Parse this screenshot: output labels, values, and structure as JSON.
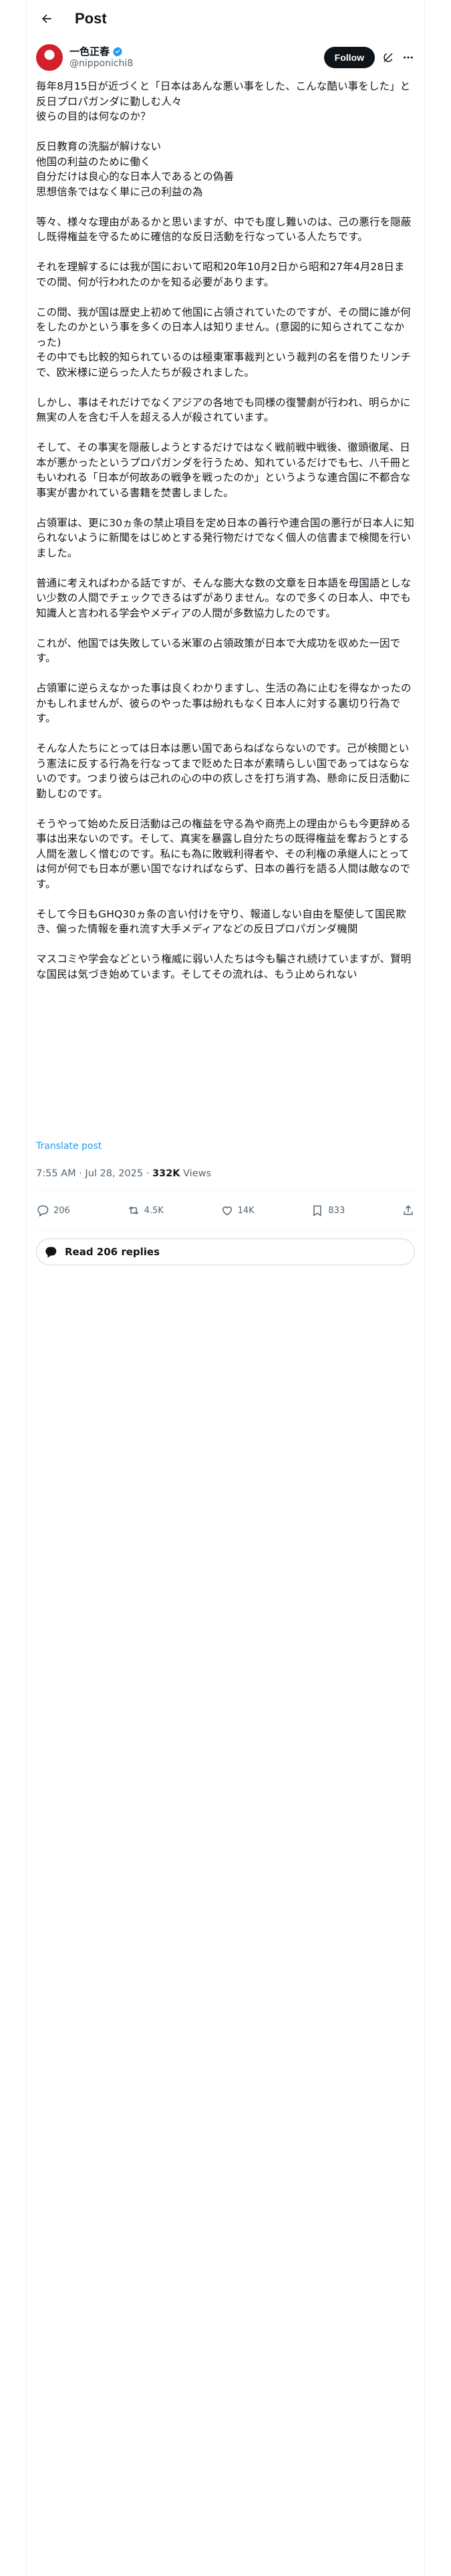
{
  "header": {
    "title": "Post"
  },
  "author": {
    "display_name": "一色正春",
    "handle": "@nipponichi8",
    "follow_label": "Follow"
  },
  "post": {
    "text": "毎年8月15日が近づくと「日本はあんな悪い事をした、こんな酷い事をした」と反日プロパガンダに勤しむ人々\n彼らの目的は何なのか？\n\n反日教育の洗脳が解けない\n他国の利益のために働く\n自分だけは良心的な日本人であるとの偽善\n思想信条ではなく単に己の利益の為\n\n等々、様々な理由があるかと思いますが、中でも度し難いのは、己の悪行を隠蔽し既得権益を守るために確信的な反日活動を行なっている人たちです。\n\nそれを理解するには我が国において昭和20年10月2日から昭和27年4月28日までの間、何が行われたのかを知る必要があります。\n\nこの間、我が国は歴史上初めて他国に占領されていたのですが、その間に誰が何をしたのかという事を多くの日本人は知りません。(意図的に知らされてこなかった)\nその中でも比較的知られているのは極東軍事裁判という裁判の名を借りたリンチで、欧米様に逆らった人たちが殺されました。\n\nしかし、事はそれだけでなくアジアの各地でも同様の復讐劇が行われ、明らかに無実の人を含む千人を超える人が殺されています。\n\nそして、その事実を隠蔽しようとするだけではなく戦前戦中戦後、徹頭徹尾、日本が悪かったというプロパガンダを行うため、知れているだけでも七、八千冊ともいわれる「日本が何故あの戦争を戦ったのか」というような連合国に不都合な事実が書かれている書籍を焚書しました。\n\n占領軍は、更に30ヵ条の禁止項目を定め日本の善行や連合国の悪行が日本人に知られないように新聞をはじめとする発行物だけでなく個人の信書まで検閲を行いました。\n\n普通に考えればわかる話ですが、そんな膨大な数の文章を日本語を母国語としない少数の人間でチェックできるはずがありません。なので多くの日本人、中でも知識人と言われる学会やメディアの人間が多数協力したのです。\n\nこれが、他国では失敗している米軍の占領政策が日本で大成功を収めた一因です。\n\n占領軍に逆らえなかった事は良くわかりますし、生活の為に止むを得なかったのかもしれませんが、彼らのやった事は紛れもなく日本人に対する裏切り行為です。\n\nそんな人たちにとっては日本は悪い国であらねばならないのです。己が検閲という憲法に反する行為を行なってまで貶めた日本が素晴らしい国であってはならないのです。つまり彼らは己れの心の中の疚しさを打ち消す為、懸命に反日活動に勤しむのです。\n\nそうやって始めた反日活動は己の権益を守る為や商売上の理由からも今更辞める事は出来ないのです。そして、真実を暴露し自分たちの既得権益を奪おうとする人間を激しく憎むのです。私にも為に敗戦利得者や、その利権の承継人にとっては何が何でも日本が悪い国でなければならず、日本の善行を語る人間は敵なのです。\n\nそして今日もGHQ30ヵ条の言い付けを守り、報道しない自由を駆使して国民欺き、偏った情報を垂れ流す大手メディアなどの反日プロパガンダ機関\n\nマスコミや学会などという権威に弱い人たちは今も騙され続けていますが、賢明な国民は気づき始めています。そしてその流れは、もう止められない",
    "translate_label": "Translate post",
    "time": "7:55 AM · Jul 28, 2025",
    "views_count": "332K",
    "views_label": " Views"
  },
  "actions": {
    "replies": "206",
    "reposts": "4.5K",
    "likes": "14K",
    "bookmarks": "833"
  },
  "read_replies": "Read 206 replies"
}
